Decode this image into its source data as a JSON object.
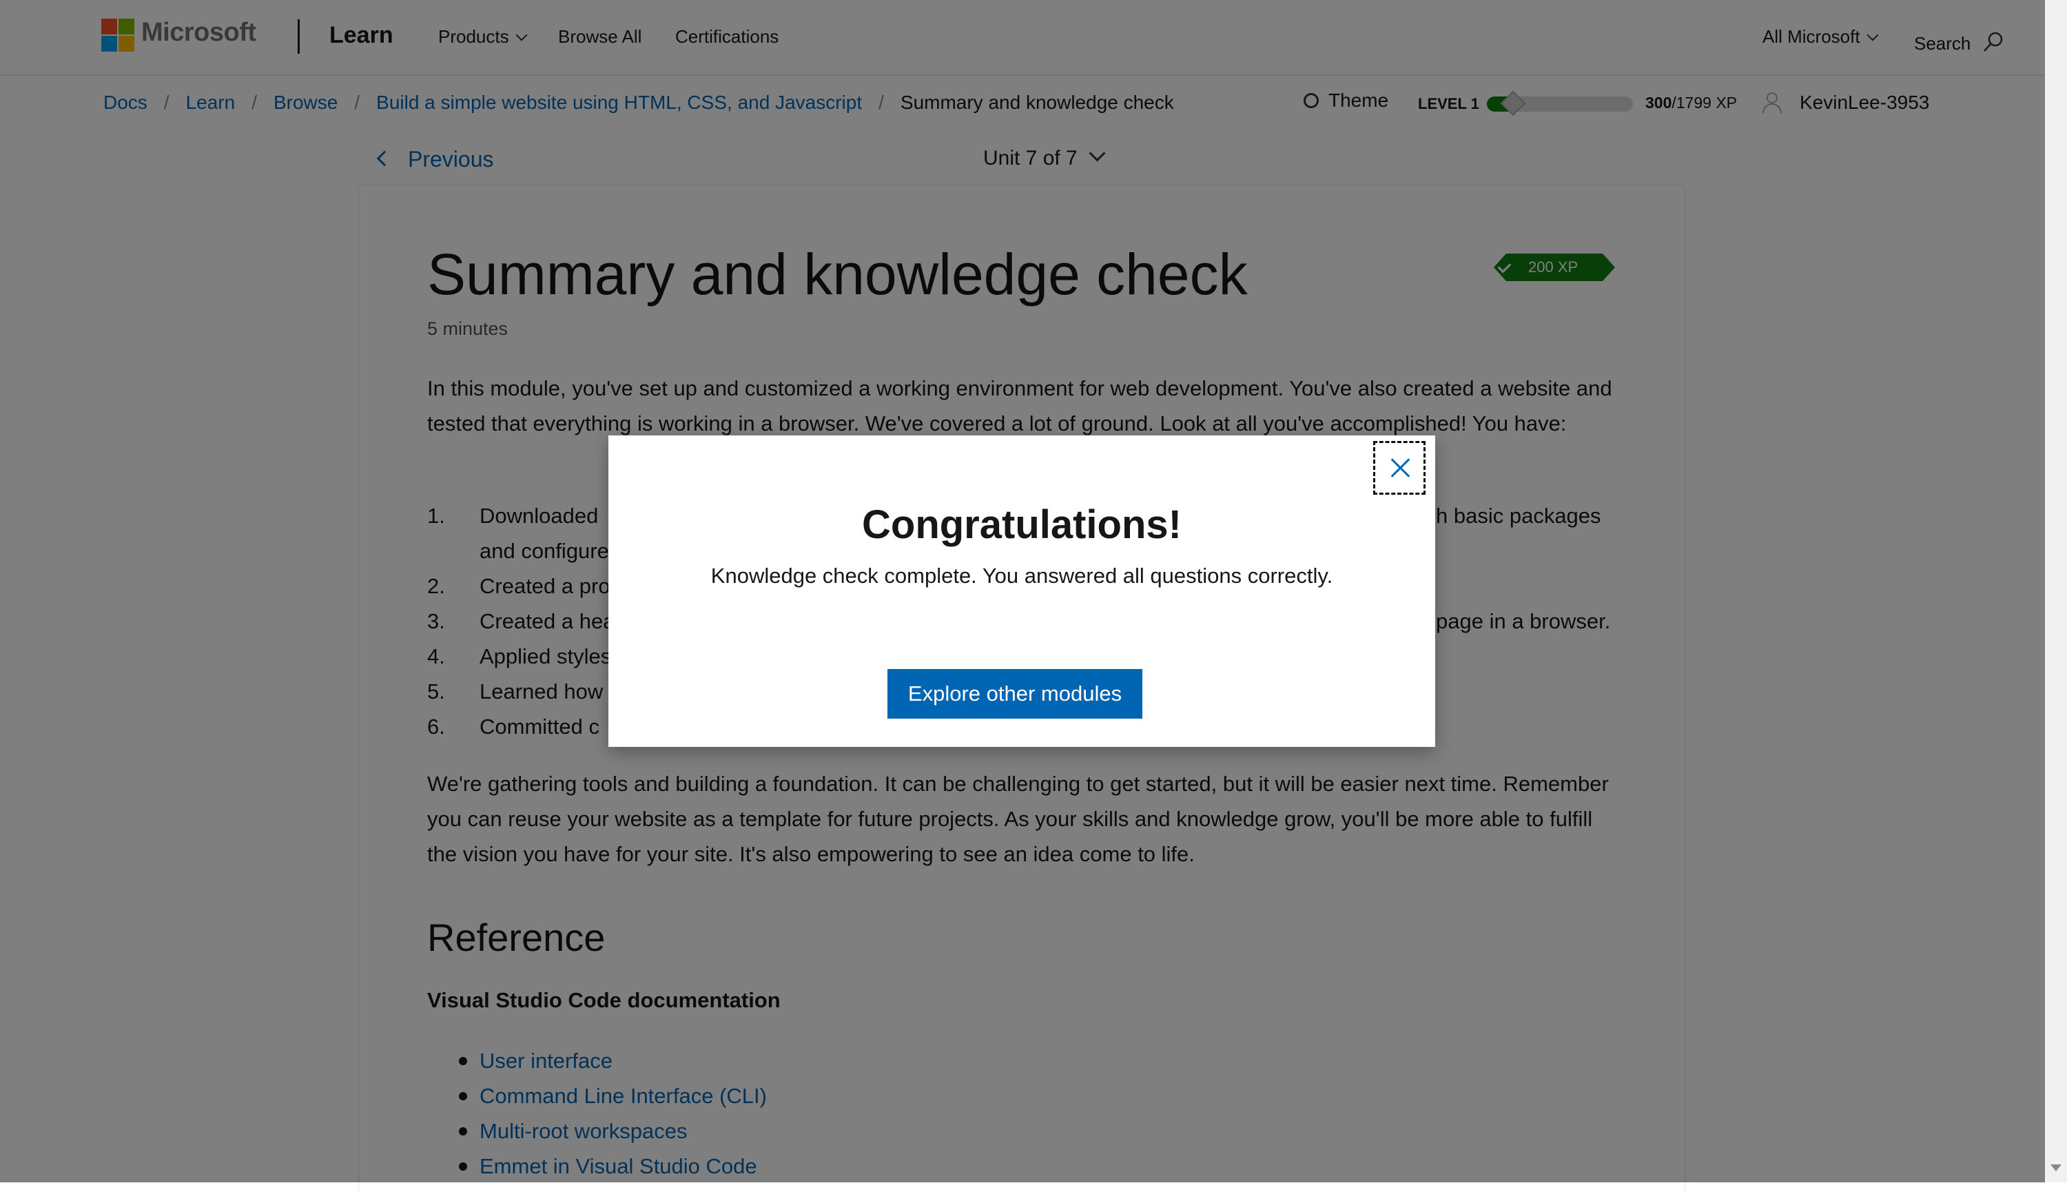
{
  "header": {
    "logo_text": "Microsoft",
    "brand": "Learn",
    "nav": [
      "Products",
      "Browse All",
      "Certifications"
    ],
    "all_microsoft": "All Microsoft",
    "search": "Search",
    "logo_colors": [
      "#f25022",
      "#7fba00",
      "#00a4ef",
      "#ffb900"
    ]
  },
  "breadcrumb": {
    "items": [
      "Docs",
      "Learn",
      "Browse",
      "Build a simple website using HTML, CSS, and Javascript"
    ],
    "current": "Summary and knowledge check"
  },
  "user": {
    "theme": "Theme",
    "level": "LEVEL 1",
    "xp_current": "300",
    "xp_total": "/1799 XP",
    "xp_progress": 0.167,
    "username": "KevinLee-3953"
  },
  "unit_nav": {
    "previous": "Previous",
    "unit": "Unit 7 of 7"
  },
  "content": {
    "title": "Summary and knowledge check",
    "xp_badge": "200 XP",
    "duration": "5 minutes",
    "intro": "In this module, you've set up and customized a working environment for web development. You've also created a website and tested that everything is working in a browser. We've covered a lot of ground. Look at all you've accomplished! You have:",
    "steps": [
      {
        "num": "1.",
        "left": "Downloaded",
        "right": "h basic packages",
        "cont": "and configure"
      },
      {
        "num": "2.",
        "left": "Created a pro"
      },
      {
        "num": "3.",
        "left": "Created a hea",
        "right": "page in a browser."
      },
      {
        "num": "4.",
        "left": "Applied styles"
      },
      {
        "num": "5.",
        "left": "Learned how"
      },
      {
        "num": "6.",
        "left": "Committed c"
      }
    ],
    "closing": "We're gathering tools and building a foundation. It can be challenging to get started, but it will be easier next time. Remember you can reuse your website as a template for future projects. As your skills and knowledge grow, you'll be more able to fulfill the vision you have for your site. It's also empowering to see an idea come to life.",
    "reference_heading": "Reference",
    "vscode_heading": "Visual Studio Code documentation",
    "links": [
      "User interface",
      "Command Line Interface (CLI)",
      "Multi-root workspaces",
      "Emmet in Visual Studio Code"
    ]
  },
  "dialog": {
    "title": "Congratulations!",
    "message": "Knowledge check complete. You answered all questions correctly.",
    "button": "Explore other modules"
  }
}
